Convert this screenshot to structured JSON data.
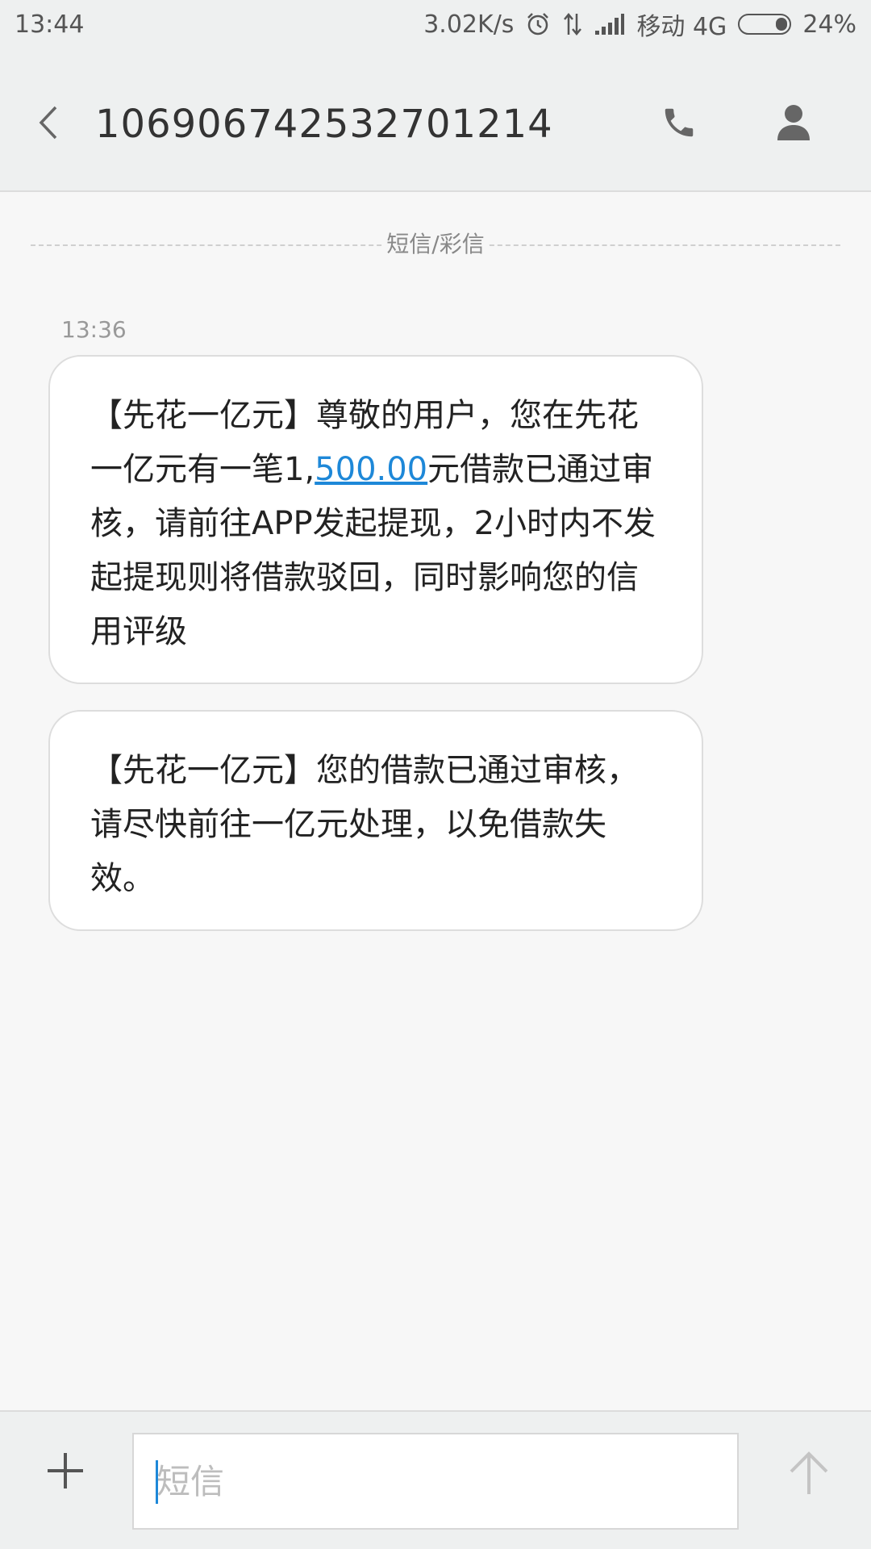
{
  "status_bar": {
    "time": "13:44",
    "network_speed": "3.02K/s",
    "carrier": "移动 4G",
    "battery": "24%",
    "icons": [
      "alarm-icon",
      "data-arrows-icon",
      "signal-icon",
      "battery-icon"
    ]
  },
  "header": {
    "title": "106906742532701214",
    "icons": [
      "back-chevron-icon",
      "phone-icon",
      "contact-person-icon"
    ]
  },
  "section_label": "短信/彩信",
  "messages": [
    {
      "time": "13:36",
      "text_before": "【先花一亿元】尊敬的用户，您在先花一亿元有一笔1,",
      "link_text": "500.00",
      "text_after": "元借款已通过审核，请前往APP发起提现，2小时内不发起提现则将借款驳回，同时影响您的信用评级"
    },
    {
      "text": "【先花一亿元】您的借款已通过审核，请尽快前往一亿元处理，以免借款失效。"
    }
  ],
  "input_bar": {
    "placeholder": "短信",
    "value": "",
    "icons": [
      "plus-icon",
      "send-arrow-icon"
    ]
  },
  "colors": {
    "accent": "#1e88d8",
    "bubble_bg": "#ffffff",
    "background": "#f7f7f7",
    "bar_bg": "#eef0f0"
  }
}
